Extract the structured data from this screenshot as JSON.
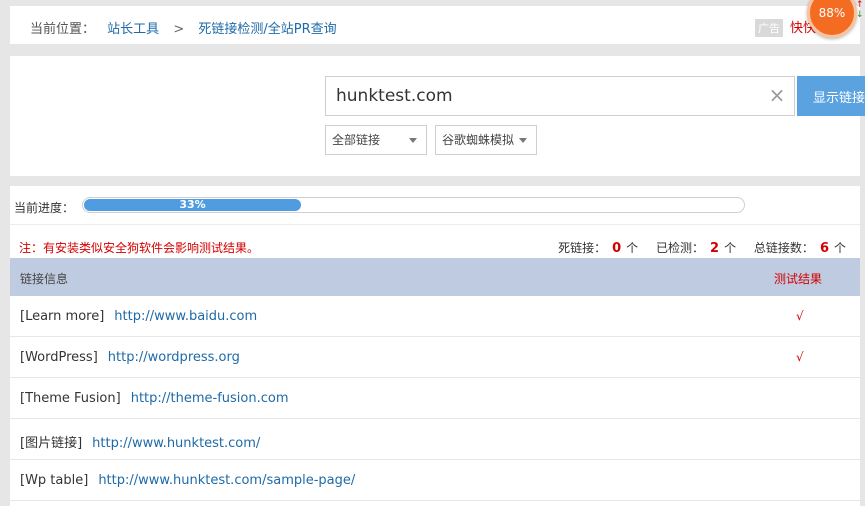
{
  "breadcrumb": {
    "label": "当前位置：",
    "items": [
      "站长工具",
      "死链接检测/全站PR查询"
    ],
    "separator": ">",
    "ad_tag": "广告",
    "ad_text": "快快"
  },
  "widget": {
    "percent": "88%",
    "up_arrow": "↑",
    "down_arrow": "↓"
  },
  "search": {
    "domain_value": "hunktest.com",
    "clear_icon": "close-icon",
    "button_label": "显示链接",
    "link_filter": "全部链接",
    "spider_mode": "谷歌蜘蛛模拟"
  },
  "progress": {
    "label": "当前进度：",
    "percent_text": "33%",
    "fraction": 0.33
  },
  "note": "注：有安装类似安全狗软件会影响测试结果。",
  "stats": {
    "dead_label": "死链接：",
    "dead_count": "0",
    "dead_unit": "个",
    "checked_label": "已检测：",
    "checked_count": "2",
    "checked_unit": "个",
    "total_label": "总链接数：",
    "total_count": "6",
    "total_unit": "个"
  },
  "table": {
    "col_info": "链接信息",
    "col_result": "测试结果",
    "rows": [
      {
        "name": "[Learn more]",
        "url": "http://www.baidu.com",
        "result": "√"
      },
      {
        "name": "[WordPress]",
        "url": "http://wordpress.org",
        "result": "√"
      },
      {
        "name": "[Theme Fusion]",
        "url": "http://theme-fusion.com",
        "result": ""
      },
      {
        "name": "[图片链接]",
        "url": "http://www.hunktest.com/",
        "result": ""
      },
      {
        "name": "[Wp table]",
        "url": "http://www.hunktest.com/sample-page/",
        "result": ""
      }
    ]
  },
  "colors": {
    "accent": "#5ba3e0",
    "alert": "#d40000",
    "table_header": "#bfcbe0",
    "link": "#1e6aa8"
  }
}
